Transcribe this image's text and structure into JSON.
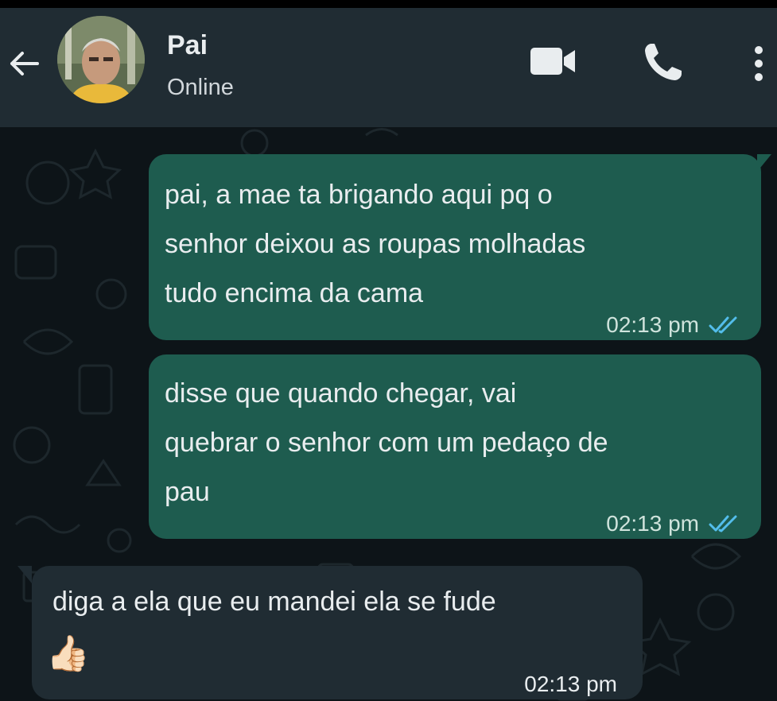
{
  "header": {
    "back_icon": "arrow-left-icon",
    "contact_name": "Pai",
    "contact_status": "Online",
    "actions": {
      "video_icon": "video-camera-icon",
      "call_icon": "phone-icon",
      "menu_icon": "more-vertical-icon"
    }
  },
  "messages": [
    {
      "direction": "outgoing",
      "text": "pai, a mae ta brigando aqui pq o\nsenhor deixou as roupas molhadas\ntudo encima da cama",
      "time": "02:13 pm",
      "status_icon": "double-check-icon"
    },
    {
      "direction": "outgoing",
      "text": "disse que quando chegar, vai\nquebrar o senhor com um pedaço de\npau",
      "time": "02:13 pm",
      "status_icon": "double-check-icon"
    },
    {
      "direction": "incoming",
      "text": "diga a ela que eu mandei ela se fude",
      "emoji": "👍🏻",
      "time": "02:13 pm"
    }
  ],
  "colors": {
    "header_bg": "#202c33",
    "chat_bg": "#0d1418",
    "outgoing_bubble": "#1e5c4f",
    "incoming_bubble": "#202c33",
    "read_ticks": "#53bdeb",
    "text": "#e9edef"
  }
}
